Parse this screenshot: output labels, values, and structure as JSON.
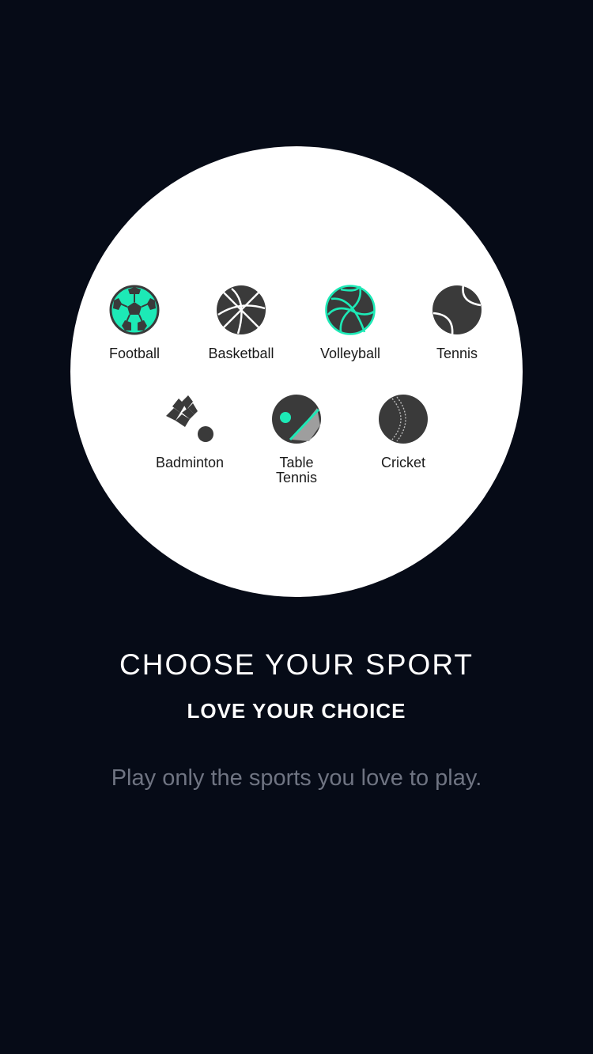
{
  "colors": {
    "background": "#060b17",
    "circle": "#ffffff",
    "accent": "#1de9b6",
    "icon_dark": "#3a3a3a",
    "tagline": "#6f7482"
  },
  "sports": [
    {
      "label": "Football",
      "icon": "football-icon",
      "selected": true
    },
    {
      "label": "Basketball",
      "icon": "basketball-icon",
      "selected": false
    },
    {
      "label": "Volleyball",
      "icon": "volleyball-icon",
      "selected": true
    },
    {
      "label": "Tennis",
      "icon": "tennis-icon",
      "selected": false
    },
    {
      "label": "Badminton",
      "icon": "shuttlecock-icon",
      "selected": false
    },
    {
      "label": "Table\nTennis",
      "icon": "table-tennis-icon",
      "selected": true
    },
    {
      "label": "Cricket",
      "icon": "cricket-ball-icon",
      "selected": false
    }
  ],
  "heading": {
    "title": "CHOOSE YOUR SPORT",
    "subtitle": "LOVE YOUR CHOICE",
    "tagline": "Play only the sports you love to play."
  }
}
